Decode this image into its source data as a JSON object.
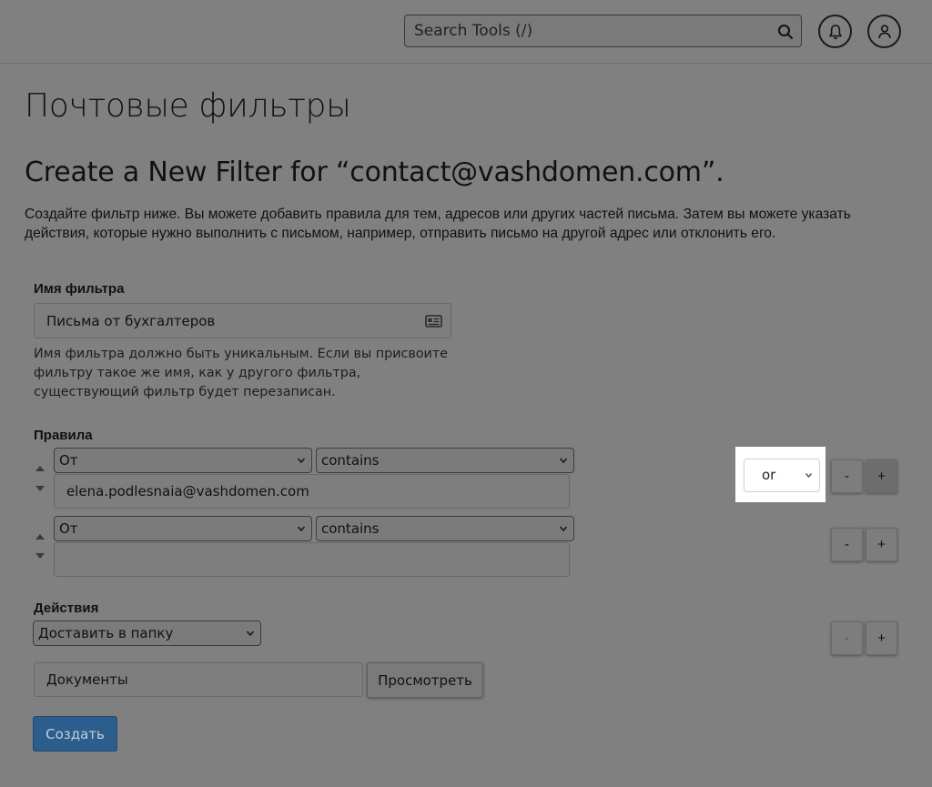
{
  "header": {
    "search_placeholder": "Search Tools (/)",
    "icons": [
      "search-icon",
      "bell-icon",
      "user-icon"
    ]
  },
  "page": {
    "title": "Почтовые фильтры",
    "subtitle": "Create a New Filter for “contact@vashdomen.com”.",
    "description": "Создайте фильтр ниже. Вы можете добавить правила для тем, адресов или других частей письма. Затем вы можете указать действия, которые нужно выполнить с письмом, например, отправить письмо на другой адрес или отклонить его."
  },
  "filter_name": {
    "label": "Имя фильтра",
    "value": "Письма от бухгалтеров",
    "help": "Имя фильтра должно быть уникальным. Если вы присвоите фильтру такое же имя, как у другого фильтра, существующий фильтр будет перезаписан."
  },
  "rules": {
    "label": "Правила",
    "items": [
      {
        "field": "От",
        "operator": "contains",
        "value": "elena.podlesnaia@vashdomen.com",
        "connector": "or"
      },
      {
        "field": "От",
        "operator": "contains",
        "value": ""
      }
    ]
  },
  "actions": {
    "label": "Действия",
    "action": "Доставить в папку",
    "folder": "Документы",
    "browse_label": "Просмотреть"
  },
  "buttons": {
    "minus": "-",
    "plus": "+",
    "create": "Создать"
  },
  "colors": {
    "overlay_gray": "#808080",
    "highlight": "#ffffff",
    "primary_button": "#2b5e8c"
  }
}
